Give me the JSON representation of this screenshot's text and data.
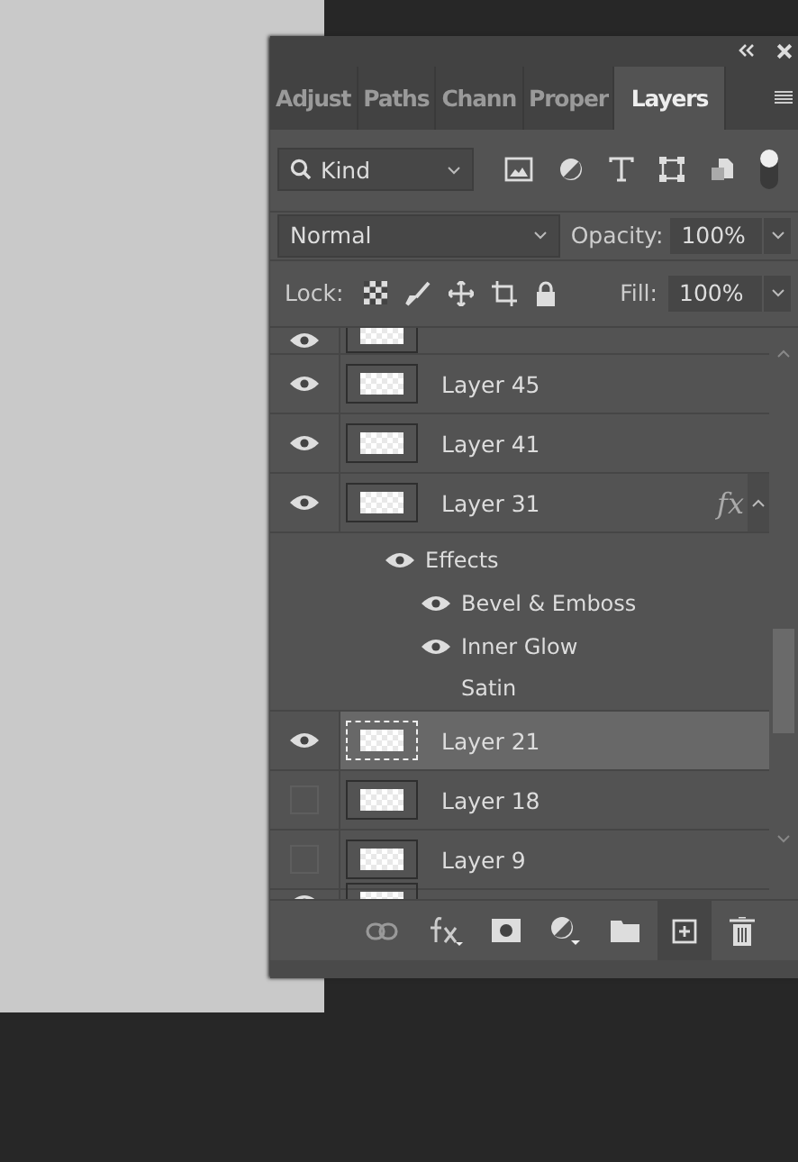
{
  "tabs": [
    {
      "label": "Adjust",
      "selected": false
    },
    {
      "label": "Paths",
      "selected": false
    },
    {
      "label": "Chann",
      "selected": false
    },
    {
      "label": "Proper",
      "selected": false
    },
    {
      "label": "Layers",
      "selected": true
    }
  ],
  "filter": {
    "value": "Kind"
  },
  "blend_mode": {
    "value": "Normal"
  },
  "opacity": {
    "label": "Opacity:",
    "value": "100%"
  },
  "lock": {
    "label": "Lock:"
  },
  "fill": {
    "label": "Fill:",
    "value": "100%"
  },
  "layers": [
    {
      "kind": "clipped",
      "visible": true,
      "selected": false
    },
    {
      "kind": "layer",
      "name": "Layer 45",
      "visible": true,
      "selected": false
    },
    {
      "kind": "layer",
      "name": "Layer 41",
      "visible": true,
      "selected": false
    },
    {
      "kind": "layer",
      "name": "Layer 31",
      "visible": true,
      "selected": false,
      "fx": "fx",
      "expanded": true,
      "effects": {
        "label": "Effects",
        "visible": true,
        "children": [
          {
            "name": "Bevel & Emboss",
            "visible": true
          },
          {
            "name": "Inner Glow",
            "visible": true
          },
          {
            "name": "Satin",
            "visible": false
          }
        ]
      }
    },
    {
      "kind": "layer",
      "name": "Layer 21",
      "visible": true,
      "selected": true
    },
    {
      "kind": "layer",
      "name": "Layer 18",
      "visible": false,
      "selected": false
    },
    {
      "kind": "layer",
      "name": "Layer 9",
      "visible": false,
      "selected": false
    },
    {
      "kind": "clipped",
      "visible": true,
      "selected": false
    }
  ]
}
